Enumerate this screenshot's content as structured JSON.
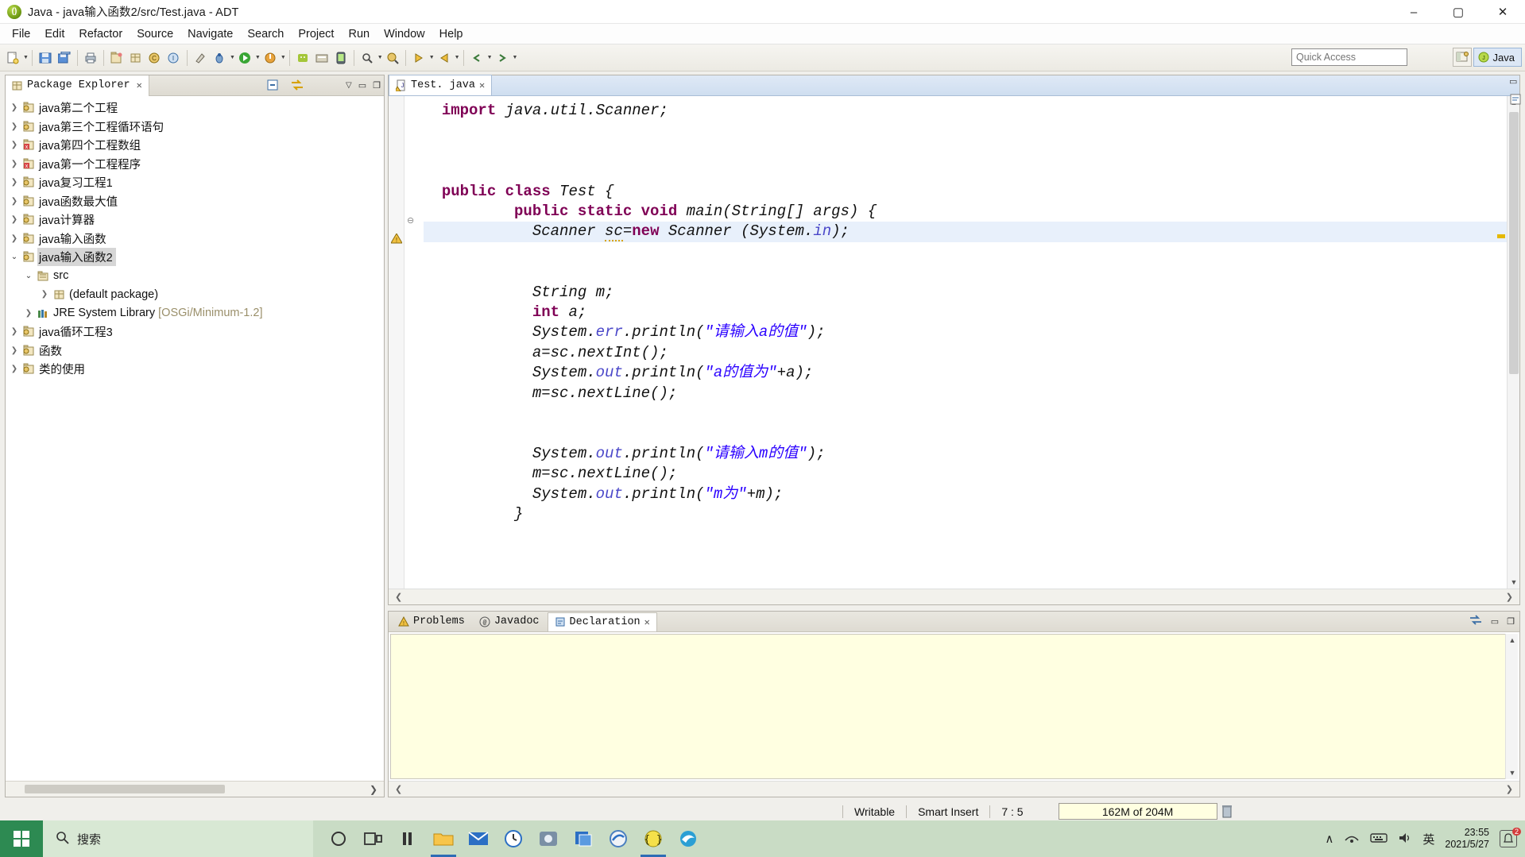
{
  "window": {
    "title": "Java - java输入函数2/src/Test.java - ADT",
    "app_icon": "java-bean-icon",
    "minimize": "–",
    "maximize": "▢",
    "close": "✕"
  },
  "menubar": [
    "File",
    "Edit",
    "Refactor",
    "Source",
    "Navigate",
    "Search",
    "Project",
    "Run",
    "Window",
    "Help"
  ],
  "toolbar": {
    "quick_access_placeholder": "Quick Access",
    "perspective_java": "Java",
    "open_perspective_icon": "open-perspective-icon",
    "java_perspective_icon": "java-perspective-icon"
  },
  "package_explorer": {
    "tab_label": "Package Explorer",
    "tab_close": "✕",
    "collapse_all_icon": "collapse-all-icon",
    "link_with_editor_icon": "link-with-editor-icon",
    "view_menu_icon": "view-menu-icon",
    "tree": [
      {
        "label": "java第二个工程",
        "level": 0,
        "arrow": "closed",
        "icon": "java-project-icon"
      },
      {
        "label": "java第三个工程循环语句",
        "level": 0,
        "arrow": "closed",
        "icon": "java-project-icon"
      },
      {
        "label": "java第四个工程数组",
        "level": 0,
        "arrow": "closed",
        "icon": "java-project-error-icon"
      },
      {
        "label": "java第一个工程程序",
        "level": 0,
        "arrow": "closed",
        "icon": "java-project-error-icon"
      },
      {
        "label": "java复习工程1",
        "level": 0,
        "arrow": "closed",
        "icon": "java-project-icon"
      },
      {
        "label": "java函数最大值",
        "level": 0,
        "arrow": "closed",
        "icon": "java-project-icon"
      },
      {
        "label": "java计算器",
        "level": 0,
        "arrow": "closed",
        "icon": "java-project-icon"
      },
      {
        "label": "java输入函数",
        "level": 0,
        "arrow": "closed",
        "icon": "java-project-icon"
      },
      {
        "label": "java输入函数2",
        "level": 0,
        "arrow": "open",
        "icon": "java-project-icon",
        "selected": true
      },
      {
        "label": "src",
        "level": 1,
        "arrow": "open",
        "icon": "source-folder-icon"
      },
      {
        "label": "(default package)",
        "level": 2,
        "arrow": "closed",
        "icon": "package-icon"
      },
      {
        "label": "JRE System Library",
        "suffix": " [OSGi/Minimum-1.2]",
        "level": 1,
        "arrow": "closed",
        "icon": "library-icon"
      },
      {
        "label": "java循环工程3",
        "level": 0,
        "arrow": "closed",
        "icon": "java-project-icon"
      },
      {
        "label": "函数",
        "level": 0,
        "arrow": "closed",
        "icon": "java-project-icon"
      },
      {
        "label": "类的使用",
        "level": 0,
        "arrow": "closed",
        "icon": "java-project-icon"
      }
    ]
  },
  "editor": {
    "tab_label": "Test. java",
    "tab_close": "✕",
    "tab_icon": "java-file-warning-icon",
    "warning_marker_icon": "warning-marker-icon",
    "fold_icon": "fold-collapse-icon",
    "code_lines": [
      {
        "indent": 0,
        "tokens": [
          {
            "t": "import ",
            "c": "kw"
          },
          {
            "t": "java.util.Scanner;",
            "c": "id"
          }
        ]
      },
      {
        "indent": 0,
        "tokens": []
      },
      {
        "indent": 0,
        "tokens": []
      },
      {
        "indent": 0,
        "tokens": []
      },
      {
        "indent": 0,
        "tokens": [
          {
            "t": "public class ",
            "c": "kw"
          },
          {
            "t": "Test {",
            "c": "id"
          }
        ]
      },
      {
        "indent": 8,
        "tokens": [
          {
            "t": "public static void ",
            "c": "kw"
          },
          {
            "t": "main(String[] args) {",
            "c": "id"
          }
        ]
      },
      {
        "indent": 10,
        "highlight": true,
        "tokens": [
          {
            "t": "Scanner ",
            "c": "id"
          },
          {
            "t": "sc",
            "c": "id squiggle"
          },
          {
            "t": "=",
            "c": "id"
          },
          {
            "t": "new",
            "c": "kw"
          },
          {
            "t": " Scanner (System.",
            "c": "id"
          },
          {
            "t": "in",
            "c": "fld"
          },
          {
            "t": ");",
            "c": "id"
          }
        ]
      },
      {
        "indent": 0,
        "tokens": []
      },
      {
        "indent": 10,
        "tokens": [
          {
            "t": "String m;",
            "c": "id"
          }
        ]
      },
      {
        "indent": 10,
        "tokens": [
          {
            "t": "int",
            "c": "kw"
          },
          {
            "t": " a;",
            "c": "id"
          }
        ]
      },
      {
        "indent": 10,
        "tokens": [
          {
            "t": "System.",
            "c": "id"
          },
          {
            "t": "err",
            "c": "fld"
          },
          {
            "t": ".println(",
            "c": "id"
          },
          {
            "t": "\"请输入a的值\"",
            "c": "str"
          },
          {
            "t": ");",
            "c": "id"
          }
        ]
      },
      {
        "indent": 10,
        "tokens": [
          {
            "t": "a=sc.nextInt();",
            "c": "id"
          }
        ]
      },
      {
        "indent": 10,
        "tokens": [
          {
            "t": "System.",
            "c": "id"
          },
          {
            "t": "out",
            "c": "fld"
          },
          {
            "t": ".println(",
            "c": "id"
          },
          {
            "t": "\"a的值为\"",
            "c": "str"
          },
          {
            "t": "+a);",
            "c": "id"
          }
        ]
      },
      {
        "indent": 10,
        "tokens": [
          {
            "t": "m=sc.nextLine();",
            "c": "id"
          }
        ]
      },
      {
        "indent": 0,
        "tokens": []
      },
      {
        "indent": 0,
        "tokens": []
      },
      {
        "indent": 10,
        "tokens": [
          {
            "t": "System.",
            "c": "id"
          },
          {
            "t": "out",
            "c": "fld"
          },
          {
            "t": ".println(",
            "c": "id"
          },
          {
            "t": "\"请输入m的值\"",
            "c": "str"
          },
          {
            "t": ");",
            "c": "id"
          }
        ]
      },
      {
        "indent": 10,
        "tokens": [
          {
            "t": "m=sc.nextLine();",
            "c": "id"
          }
        ]
      },
      {
        "indent": 10,
        "tokens": [
          {
            "t": "System.",
            "c": "id"
          },
          {
            "t": "out",
            "c": "fld"
          },
          {
            "t": ".println(",
            "c": "id"
          },
          {
            "t": "\"m为\"",
            "c": "str"
          },
          {
            "t": "+m);",
            "c": "id"
          }
        ]
      },
      {
        "indent": 8,
        "tokens": [
          {
            "t": "}",
            "c": "id"
          }
        ]
      }
    ]
  },
  "bottom_view": {
    "tabs": [
      {
        "label": "Problems",
        "icon": "problems-icon",
        "active": false
      },
      {
        "label": "Javadoc",
        "icon": "javadoc-icon",
        "active": false
      },
      {
        "label": "Declaration",
        "icon": "declaration-icon",
        "active": true,
        "close": "✕"
      }
    ],
    "minimize_icon": "minimize-icon",
    "maximize_icon": "maximize-icon",
    "pin_icon": "pin-icon"
  },
  "statusbar": {
    "writable": "Writable",
    "insert_mode": "Smart Insert",
    "cursor_position": "7 : 5",
    "heap": "162M of 204M",
    "trash_icon": "trash-icon"
  },
  "taskbar": {
    "start_icon": "windows-start-icon",
    "search_icon": "search-icon",
    "search_text": "搜索",
    "items": [
      {
        "name": "cortana-icon",
        "glyph": "◯"
      },
      {
        "name": "task-view-icon",
        "glyph": "❏"
      },
      {
        "name": "widgets-icon",
        "glyph": "▯▯"
      },
      {
        "name": "file-explorer-icon",
        "glyph": "📁"
      },
      {
        "name": "mail-icon",
        "glyph": "✉"
      },
      {
        "name": "clock-icon",
        "glyph": "🕐"
      },
      {
        "name": "media-player-icon",
        "glyph": "🎬"
      },
      {
        "name": "apps-icon",
        "glyph": "❑"
      },
      {
        "name": "browser-icon",
        "glyph": "◉"
      },
      {
        "name": "eclipse-icon",
        "glyph": "{ }"
      },
      {
        "name": "edge-icon",
        "glyph": "◑"
      }
    ],
    "tray": {
      "chevron_up": "∧",
      "network_icon": "network-icon",
      "volume_icon": "volume-icon",
      "ime_icon": "中",
      "ime_text": "英",
      "time": "23:55",
      "date": "2021/5/27",
      "notification_icon": "notification-icon",
      "notification_count": "2"
    }
  }
}
